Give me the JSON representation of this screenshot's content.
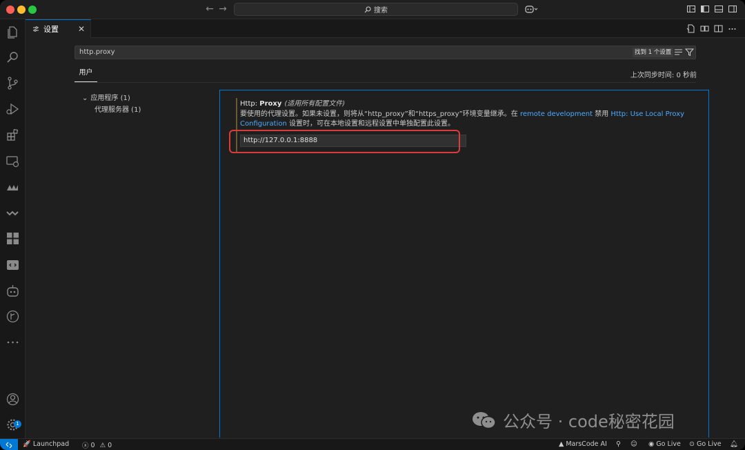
{
  "titlebar": {
    "search_label": "搜索"
  },
  "tab": {
    "label": "设置"
  },
  "settings": {
    "search_value": "http.proxy",
    "found_label": "找到 1 个设置",
    "scope_tab": "用户",
    "sync_status": "上次同步时间: 0 秒前",
    "toc": {
      "group": "应用程序 (1)",
      "child": "代理服务器 (1)"
    },
    "item": {
      "title_prefix": "Http: ",
      "title_name": "Proxy",
      "title_scope": "(适用所有配置文件)",
      "desc_part1": "要使用的代理设置。如果未设置，则将从“http_proxy”和“https_proxy”环境变量继承。在 ",
      "desc_link1": "remote development",
      "desc_part2": " 禁用 ",
      "desc_link2": "Http: Use Local Proxy Configuration",
      "desc_part3": " 设置时，可在本地设置和远程设置中单独配置此设置。",
      "value": "http://127.0.0.1:8888"
    }
  },
  "watermark": {
    "text": "公众号 · code秘密花园"
  },
  "activity_badge": "1",
  "statusbar": {
    "launchpad": "Launchpad",
    "errors": "0",
    "warnings": "0",
    "marscode": "MarsCode AI",
    "golive1": "Go Live",
    "golive2": "Go Live"
  },
  "colors": {
    "accent": "#0078d4",
    "highlight": "#e03b3b",
    "link": "#4daafc"
  }
}
